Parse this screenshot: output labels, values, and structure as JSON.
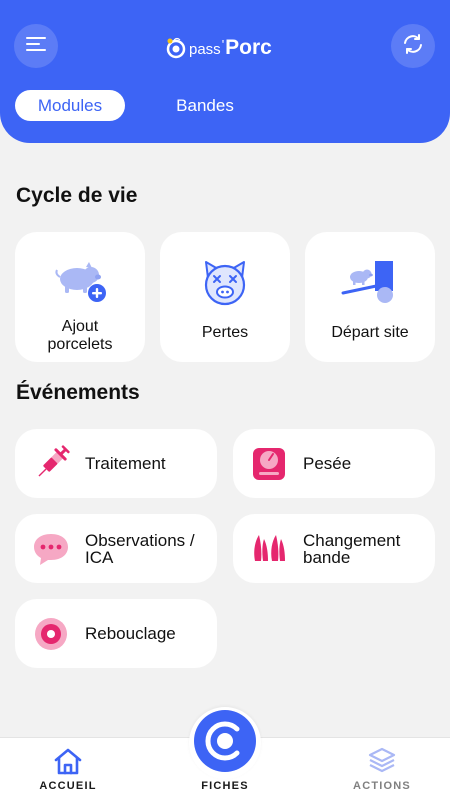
{
  "app": {
    "logo_prefix": "pass",
    "logo_sep": "'",
    "logo_name": "Porc"
  },
  "colors": {
    "primary": "#3d64f5",
    "accent_pink": "#e5276e",
    "icon_light_blue": "#aab8f5",
    "background": "#f2f2f2",
    "card": "#ffffff"
  },
  "header": {
    "menu_icon": "hamburger-menu-icon",
    "sync_icon": "sync-refresh-icon",
    "tabs": [
      {
        "label": "Modules",
        "active": true
      },
      {
        "label": "Bandes",
        "active": false
      }
    ]
  },
  "cycle": {
    "title": "Cycle de vie",
    "items": [
      {
        "label": "Ajout porcelets",
        "icon": "add-piglet-icon"
      },
      {
        "label": "Pertes",
        "icon": "dead-pig-icon"
      },
      {
        "label": "Départ site",
        "icon": "pig-departure-icon"
      }
    ]
  },
  "events": {
    "title": "Événements",
    "items": [
      {
        "label": "Traitement",
        "icon": "syringe-icon"
      },
      {
        "label": "Pesée",
        "icon": "scale-icon"
      },
      {
        "label": "Observations / ICA",
        "icon": "chat-bubble-icon"
      },
      {
        "label": "Changement bande",
        "icon": "hoof-prints-icon"
      },
      {
        "label": "Rebouclage",
        "icon": "ear-tag-icon"
      }
    ]
  },
  "bottom_nav": {
    "home": {
      "label": "ACCUEIL",
      "icon": "home-icon",
      "active": true
    },
    "fiches": {
      "label": "FICHES",
      "icon": "epass-c-logo-icon"
    },
    "actions": {
      "label": "ACTIONS",
      "icon": "layers-stack-icon",
      "active": false
    }
  }
}
